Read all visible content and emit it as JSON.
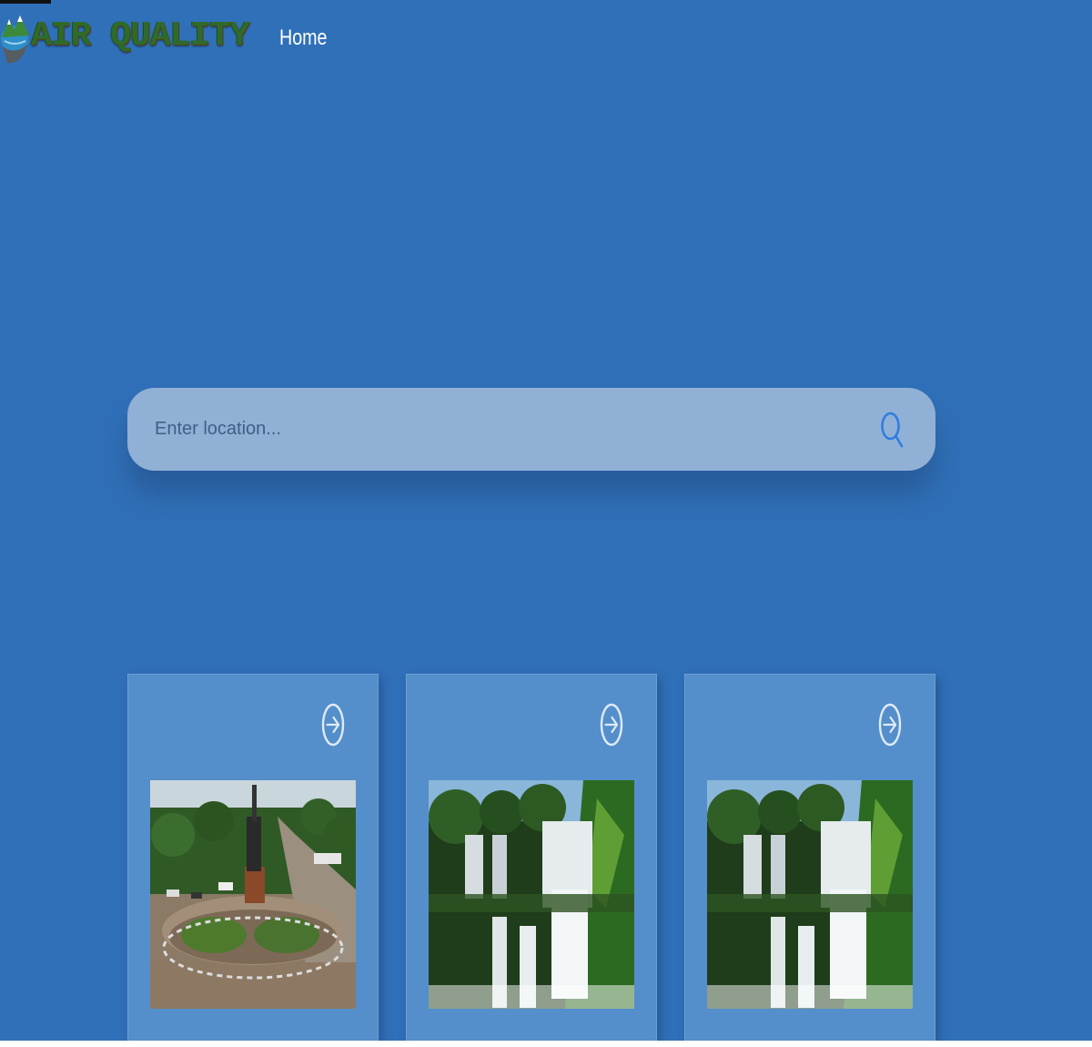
{
  "header": {
    "logo_text": "AIR QUALITY",
    "nav": [
      {
        "label": "Home"
      }
    ]
  },
  "search": {
    "placeholder": "Enter location..."
  },
  "cards": [
    {
      "image": "city-roundabout-monument",
      "icon": "arrow-circle-right-icon"
    },
    {
      "image": "waterfall",
      "icon": "arrow-circle-right-icon"
    },
    {
      "image": "waterfall",
      "icon": "arrow-circle-right-icon"
    }
  ],
  "colors": {
    "background": "#3070b8",
    "search_bar": "#91b0d6",
    "card": "#548fcb",
    "icon": "#dfeaf6",
    "search_icon": "#2f7de0"
  }
}
